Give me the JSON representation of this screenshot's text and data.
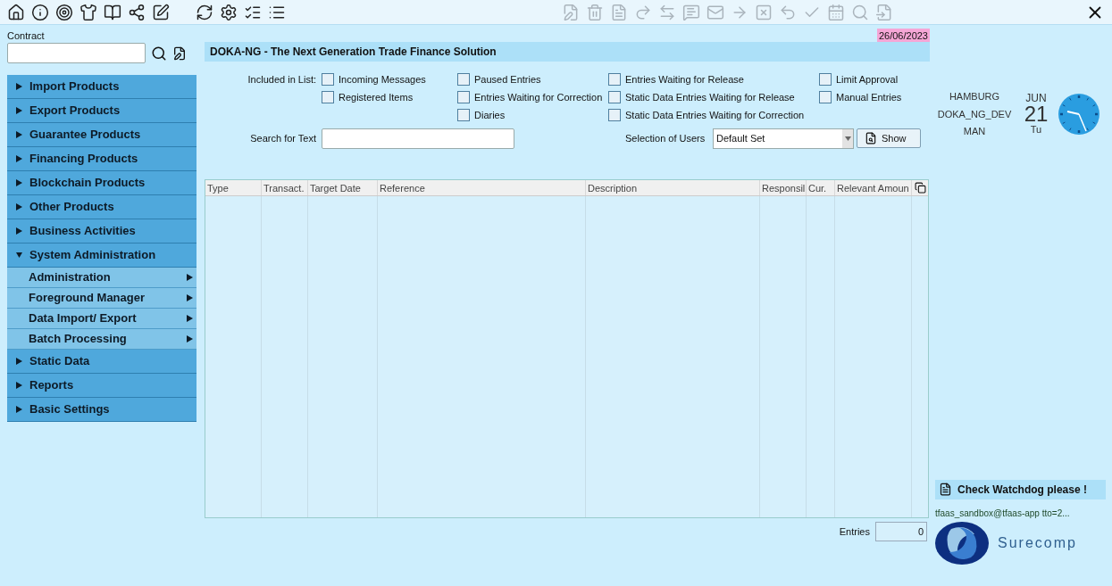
{
  "toolbar": [
    {
      "disabled": false
    },
    {
      "disabled": false
    },
    {
      "disabled": false
    },
    {
      "disabled": false
    },
    {
      "disabled": false
    },
    {
      "disabled": false
    },
    {
      "disabled": false
    },
    {
      "disabled": false
    },
    {
      "disabled": false
    },
    {
      "disabled": false
    },
    {
      "disabled": false
    },
    {
      "disabled": true
    },
    {
      "disabled": true
    },
    {
      "disabled": true
    },
    {
      "disabled": true
    },
    {
      "disabled": true
    },
    {
      "disabled": true
    },
    {
      "disabled": true
    },
    {
      "disabled": true
    },
    {
      "disabled": true
    },
    {
      "disabled": true
    },
    {
      "disabled": true
    },
    {
      "disabled": true
    },
    {
      "disabled": true
    },
    {
      "disabled": true
    }
  ],
  "contract": {
    "label": "Contract"
  },
  "sidebar": {
    "items": [
      {
        "label": "Import Products",
        "expanded": false
      },
      {
        "label": "Export Products",
        "expanded": false
      },
      {
        "label": "Guarantee Products",
        "expanded": false
      },
      {
        "label": "Financing Products",
        "expanded": false
      },
      {
        "label": "Blockchain Products",
        "expanded": false
      },
      {
        "label": "Other Products",
        "expanded": false
      },
      {
        "label": "Business Activities",
        "expanded": false
      },
      {
        "label": "System Administration",
        "expanded": true,
        "children": [
          {
            "label": "Administration"
          },
          {
            "label": "Foreground Manager"
          },
          {
            "label": "Data Import/ Export"
          },
          {
            "label": "Batch Processing"
          }
        ]
      },
      {
        "label": "Static Data",
        "expanded": false
      },
      {
        "label": "Reports",
        "expanded": false
      },
      {
        "label": "Basic Settings",
        "expanded": false
      }
    ]
  },
  "date": "26/06/2023",
  "title": "DOKA-NG - The Next Generation Trade Finance Solution",
  "filter": {
    "label": "Included in List:",
    "columns": [
      [
        {
          "label": "Incoming Messages",
          "checked": false
        },
        {
          "label": "Registered Items",
          "checked": false
        }
      ],
      [
        {
          "label": "Paused Entries",
          "checked": false
        },
        {
          "label": "Entries Waiting for Correction",
          "checked": false
        },
        {
          "label": "Diaries",
          "checked": false
        }
      ],
      [
        {
          "label": "Entries Waiting for Release",
          "checked": false
        },
        {
          "label": "Static Data Entries Waiting for Release",
          "checked": false
        },
        {
          "label": "Static Data Entries Waiting for Correction",
          "checked": false
        }
      ],
      [
        {
          "label": "Limit Approval",
          "checked": false
        },
        {
          "label": "Manual Entries",
          "checked": false
        }
      ]
    ]
  },
  "search": {
    "label": "Search for Text"
  },
  "users": {
    "label": "Selection of Users",
    "value": "Default Set"
  },
  "show_button": "Show",
  "table": {
    "columns": [
      "Type",
      "Transact.",
      "Target Date",
      "Reference",
      "Description",
      "Responsil",
      "Cur.",
      "Relevant Amoun"
    ]
  },
  "entries": {
    "label": "Entries",
    "value": "0"
  },
  "user_info": [
    "HAMBURG",
    "DOKA_NG_DEV",
    "MAN"
  ],
  "calendar": {
    "month": "JUN",
    "day": "21",
    "weekday": "Tu"
  },
  "watchdog": "Check Watchdog please !",
  "session": "tfaas_sandbox@tfaas-app tto=2...",
  "logo_text": "Surecomp"
}
